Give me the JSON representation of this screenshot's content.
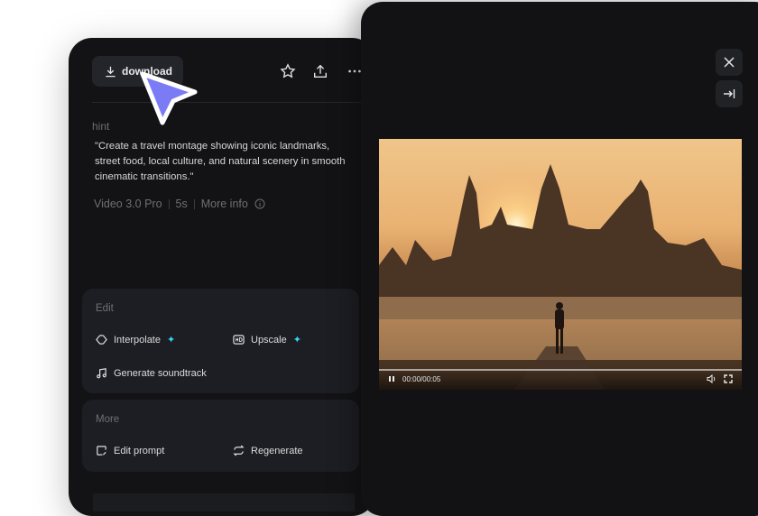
{
  "toolbar": {
    "download_label": "download"
  },
  "details": {
    "hint_label": "hint",
    "prompt": "\"Create a travel montage showing iconic landmarks, street food, local culture, and natural scenery in smooth cinematic transitions.\"",
    "model": "Video 3.0 Pro",
    "duration": "5s",
    "more_info": "More info"
  },
  "edit": {
    "title": "Edit",
    "items": [
      {
        "label": "Interpolate",
        "icon": "interpolate-icon"
      },
      {
        "label": "Upscale",
        "icon": "hd-icon"
      },
      {
        "label": "Generate soundtrack",
        "icon": "music-note-icon"
      }
    ]
  },
  "more": {
    "title": "More",
    "items": [
      {
        "label": "Edit prompt",
        "icon": "edit-prompt-icon"
      },
      {
        "label": "Regenerate",
        "icon": "regenerate-icon"
      }
    ]
  },
  "player": {
    "time": "00:00/00:05",
    "progress": 0
  },
  "colors": {
    "accent_sparkle": "#38d6f2",
    "cursor": "#7b7cf5"
  }
}
